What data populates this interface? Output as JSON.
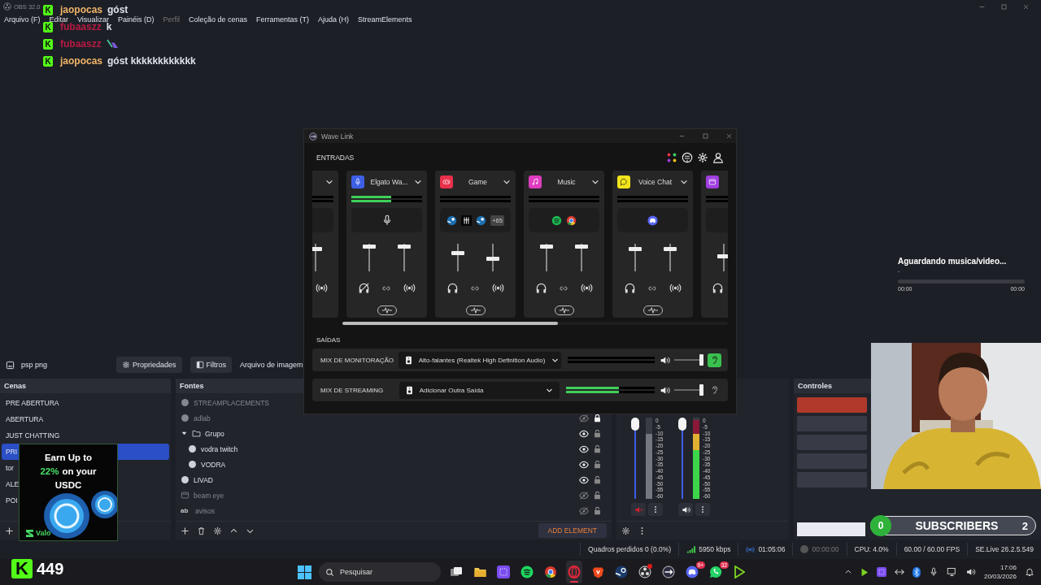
{
  "titlebar": {
    "title": "OBS 32.0"
  },
  "menu": [
    {
      "label": "Arquivo (F)",
      "disabled": false
    },
    {
      "label": "Editar",
      "disabled": false
    },
    {
      "label": "Visualizar",
      "disabled": false
    },
    {
      "label": "Painéis (D)",
      "disabled": false
    },
    {
      "label": "Perfil",
      "disabled": true
    },
    {
      "label": "Coleção de cenas",
      "disabled": false
    },
    {
      "label": "Ferramentas (T)",
      "disabled": false
    },
    {
      "label": "Ajuda (H)",
      "disabled": false
    },
    {
      "label": "StreamElements",
      "disabled": false
    }
  ],
  "chat": [
    {
      "badge": "K",
      "user": "jaopocas",
      "color": "#f0b468",
      "kind": "text",
      "text": "góst"
    },
    {
      "badge": "K",
      "user": "fubaaszz",
      "color": "#b81a44",
      "kind": "text",
      "text": "k"
    },
    {
      "badge": "K",
      "user": "fubaaszz",
      "color": "#b81a44",
      "kind": "emote"
    },
    {
      "badge": "K",
      "user": "jaopocas",
      "color": "#f0b468",
      "kind": "text",
      "text": "góst kkkkkkkkkkkk"
    }
  ],
  "music_widget": {
    "title": "Aguardando musica/video...",
    "subtitle": "-",
    "progress": {
      "level": 0
    },
    "elapsed": "00:00",
    "total": "00:00"
  },
  "source_toolbar": {
    "source": "psp png",
    "buttons": [
      {
        "kind": "properties",
        "label": "Propriedades"
      },
      {
        "kind": "filters",
        "label": "Filtros"
      }
    ],
    "type": "Arquivo de imagem"
  },
  "scenes": {
    "title": "Cenas",
    "items": [
      {
        "label": "PRE ABERTURA",
        "selected": false
      },
      {
        "label": "ABERTURA",
        "selected": false
      },
      {
        "label": "JUST CHATTING",
        "selected": false
      },
      {
        "label": "PRI",
        "selected": true
      },
      {
        "label": "tor",
        "selected": false
      },
      {
        "label": "ALE",
        "selected": false
      },
      {
        "label": "POI",
        "selected": false
      }
    ]
  },
  "sources": {
    "title": "Fontes",
    "add_label": "ADD ELEMENT",
    "items": [
      {
        "label": "STREAMPLACEMENTS",
        "kind": "browser",
        "visible": false
      },
      {
        "label": "adlab",
        "kind": "browser",
        "visible": false,
        "locked": true
      },
      {
        "label": "Grupo",
        "kind": "group",
        "visible": true,
        "locked": false,
        "expanded": true,
        "children": [
          {
            "label": "vodra twitch",
            "kind": "browser",
            "visible": true,
            "locked": false
          },
          {
            "label": "VODRA",
            "kind": "browser",
            "visible": true,
            "locked": false
          }
        ]
      },
      {
        "label": "LIVAD",
        "kind": "browser",
        "visible": true,
        "locked": false
      },
      {
        "label": "beam eye",
        "kind": "window",
        "visible": false,
        "locked": false
      },
      {
        "label": "avisos",
        "kind": "text",
        "badge": "ab",
        "visible": false,
        "locked": false
      }
    ]
  },
  "mixer": {
    "channels": [
      {
        "muted": true,
        "fader": {
          "level": 1
        },
        "meter": {
          "level": 0.8
        },
        "scale": [
          "0",
          "-5",
          "-10",
          "-15",
          "-20",
          "-25",
          "-30",
          "-35",
          "-40",
          "-45",
          "-50",
          "-55",
          "-60"
        ]
      },
      {
        "muted": false,
        "fader": {
          "level": 1
        },
        "meter": {
          "level": 0.97
        },
        "scale": [
          "0",
          "-5",
          "-10",
          "-15",
          "-20",
          "-25",
          "-30",
          "-35",
          "-40",
          "-45",
          "-50",
          "-55",
          "-60"
        ]
      }
    ]
  },
  "controls": {
    "title": "Controles",
    "buttons": [
      {
        "active": true
      },
      {
        "active": false
      },
      {
        "active": false
      },
      {
        "active": false
      },
      {
        "active": false
      }
    ]
  },
  "status_bar": {
    "dropped": "Quadros perdidos 0 (0.0%)",
    "bitrate": "5950 kbps",
    "stream_time": "01:05:06",
    "record_time": "00:00:00",
    "cpu": "CPU: 4.0%",
    "fps": "60.00 / 60.00 FPS",
    "version": "SE.Live 26.2.5.549"
  },
  "wavelink": {
    "title": "Wave Link",
    "inputs_label": "ENTRADAS",
    "outputs_label": "SAÍDAS",
    "channels": [
      {
        "meter": {
          "level": 0
        },
        "stream": {
          "level": 0.85
        }
      },
      {
        "name": "Elgato Wa...",
        "kind": "mic",
        "color": "#3d5fe6",
        "meter": {
          "level": 0.56
        },
        "monitor": {
          "level": 0.95,
          "muted": true
        },
        "stream": {
          "level": 0.95
        },
        "apps": [
          {
            "kind": "mic"
          }
        ]
      },
      {
        "name": "Game",
        "kind": "gamepad",
        "color": "#e8304a",
        "meter": {
          "level": 0
        },
        "monitor": {
          "level": 0.7,
          "muted": false
        },
        "stream": {
          "level": 0.45
        },
        "apps": [
          {
            "kind": "steam"
          },
          {
            "kind": "tile"
          },
          {
            "kind": "steam"
          },
          {
            "kind": "more",
            "label": "+65"
          }
        ]
      },
      {
        "name": "Music",
        "kind": "note",
        "color": "#e03cc0",
        "meter": {
          "level": 0
        },
        "monitor": {
          "level": 0.95,
          "muted": false
        },
        "stream": {
          "level": 0.95
        },
        "apps": [
          {
            "kind": "spotify"
          },
          {
            "kind": "chrome"
          }
        ]
      },
      {
        "name": "Voice Chat",
        "kind": "chat",
        "color": "#f2e41c",
        "meter": {
          "level": 0
        },
        "monitor": {
          "level": 0.85,
          "muted": false
        },
        "stream": {
          "level": 0.85
        },
        "apps": [
          {
            "kind": "discord"
          }
        ]
      },
      {
        "kind": "window",
        "color": "#a03ee0",
        "meter": {
          "level": 0
        },
        "monitor": {
          "level": 0.55,
          "muted": false
        }
      }
    ],
    "outputs": [
      {
        "label": "MIX DE MONITORAÇÃO",
        "device": "Alto-falantes (Realtek High Definition Audio)",
        "meter": {
          "level": 0
        },
        "volume": {
          "level": 1
        },
        "listening": true
      },
      {
        "label": "MIX DE STREAMING",
        "device": "Adicionar Outra Saída",
        "meter": {
          "level": 0.6
        },
        "volume": {
          "level": 1
        },
        "listening": false
      }
    ]
  },
  "ad": {
    "line1": "Earn Up to",
    "highlight": "22%",
    "line2": "on your",
    "line3": "USDC",
    "brand": "Valo"
  },
  "subscribers": {
    "count": "0",
    "label": "SUBSCRIBERS",
    "goal": "2"
  },
  "kick_counter": {
    "badge": "K",
    "count": "449"
  },
  "taskbar": {
    "search": "Pesquisar",
    "apps": [
      {
        "kind": "taskview",
        "selected": false,
        "alert": false
      },
      {
        "kind": "folder",
        "selected": false,
        "alert": false
      },
      {
        "kind": "grid",
        "selected": false,
        "alert": false
      },
      {
        "kind": "spotify",
        "selected": false,
        "alert": false
      },
      {
        "kind": "chrome",
        "selected": false,
        "alert": false
      },
      {
        "kind": "opera",
        "selected": true,
        "alert": false
      },
      {
        "kind": "brave",
        "selected": false,
        "alert": false
      },
      {
        "kind": "steam",
        "selected": false,
        "alert": false
      },
      {
        "kind": "obs",
        "selected": false,
        "alert": true
      },
      {
        "kind": "wavelink",
        "selected": false,
        "alert": false
      },
      {
        "kind": "discord",
        "badge": "9+",
        "selected": false,
        "alert": false
      },
      {
        "kind": "whatsapp",
        "badge": "32",
        "selected": false,
        "alert": false
      },
      {
        "kind": "play",
        "selected": false,
        "alert": false
      }
    ],
    "tray": [
      {
        "kind": "chevron"
      },
      {
        "kind": "play"
      },
      {
        "kind": "grid"
      },
      {
        "kind": "arrows"
      },
      {
        "kind": "bluetooth"
      },
      {
        "kind": "mic"
      },
      {
        "kind": "network"
      },
      {
        "kind": "speaker"
      }
    ],
    "time": "17:06",
    "date": "20/03/2026"
  }
}
